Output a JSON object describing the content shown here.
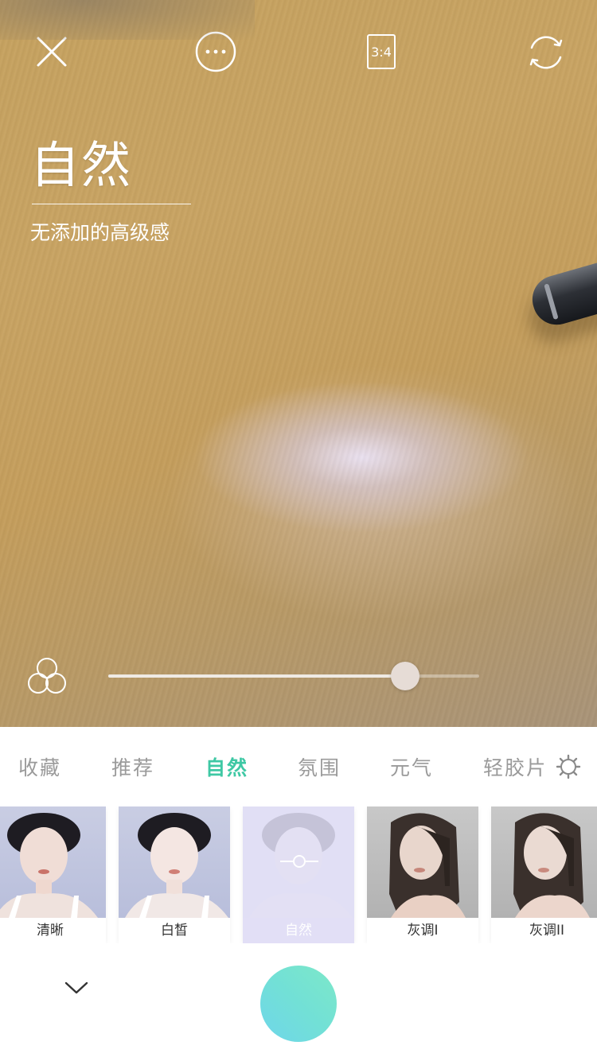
{
  "camera": {
    "ratio_label": "3:4",
    "filter_title": "自然",
    "filter_subtitle": "无添加的高级感",
    "intensity": 0.8
  },
  "icons": {
    "close": "close-icon",
    "more": "more-icon",
    "ratio": "aspect-ratio-icon",
    "flip": "flip-camera-icon",
    "layers": "filter-layers-icon",
    "settings": "settings-gear-icon",
    "adjust": "adjust-slider-icon",
    "collapse": "chevron-down-icon"
  },
  "categories": [
    "收藏",
    "推荐",
    "自然",
    "氛围",
    "元气",
    "轻胶片"
  ],
  "active_category": "自然",
  "filters": [
    {
      "label": "清晰"
    },
    {
      "label": "白皙"
    },
    {
      "label": "自然"
    },
    {
      "label": "灰调I"
    },
    {
      "label": "灰调II"
    }
  ],
  "selected_filter": "自然",
  "colors": {
    "accent": "#3ec8a4",
    "shutter_start": "#7de8c8",
    "shutter_end": "#6fd6ea",
    "tab_inactive": "#9a9a9a"
  }
}
